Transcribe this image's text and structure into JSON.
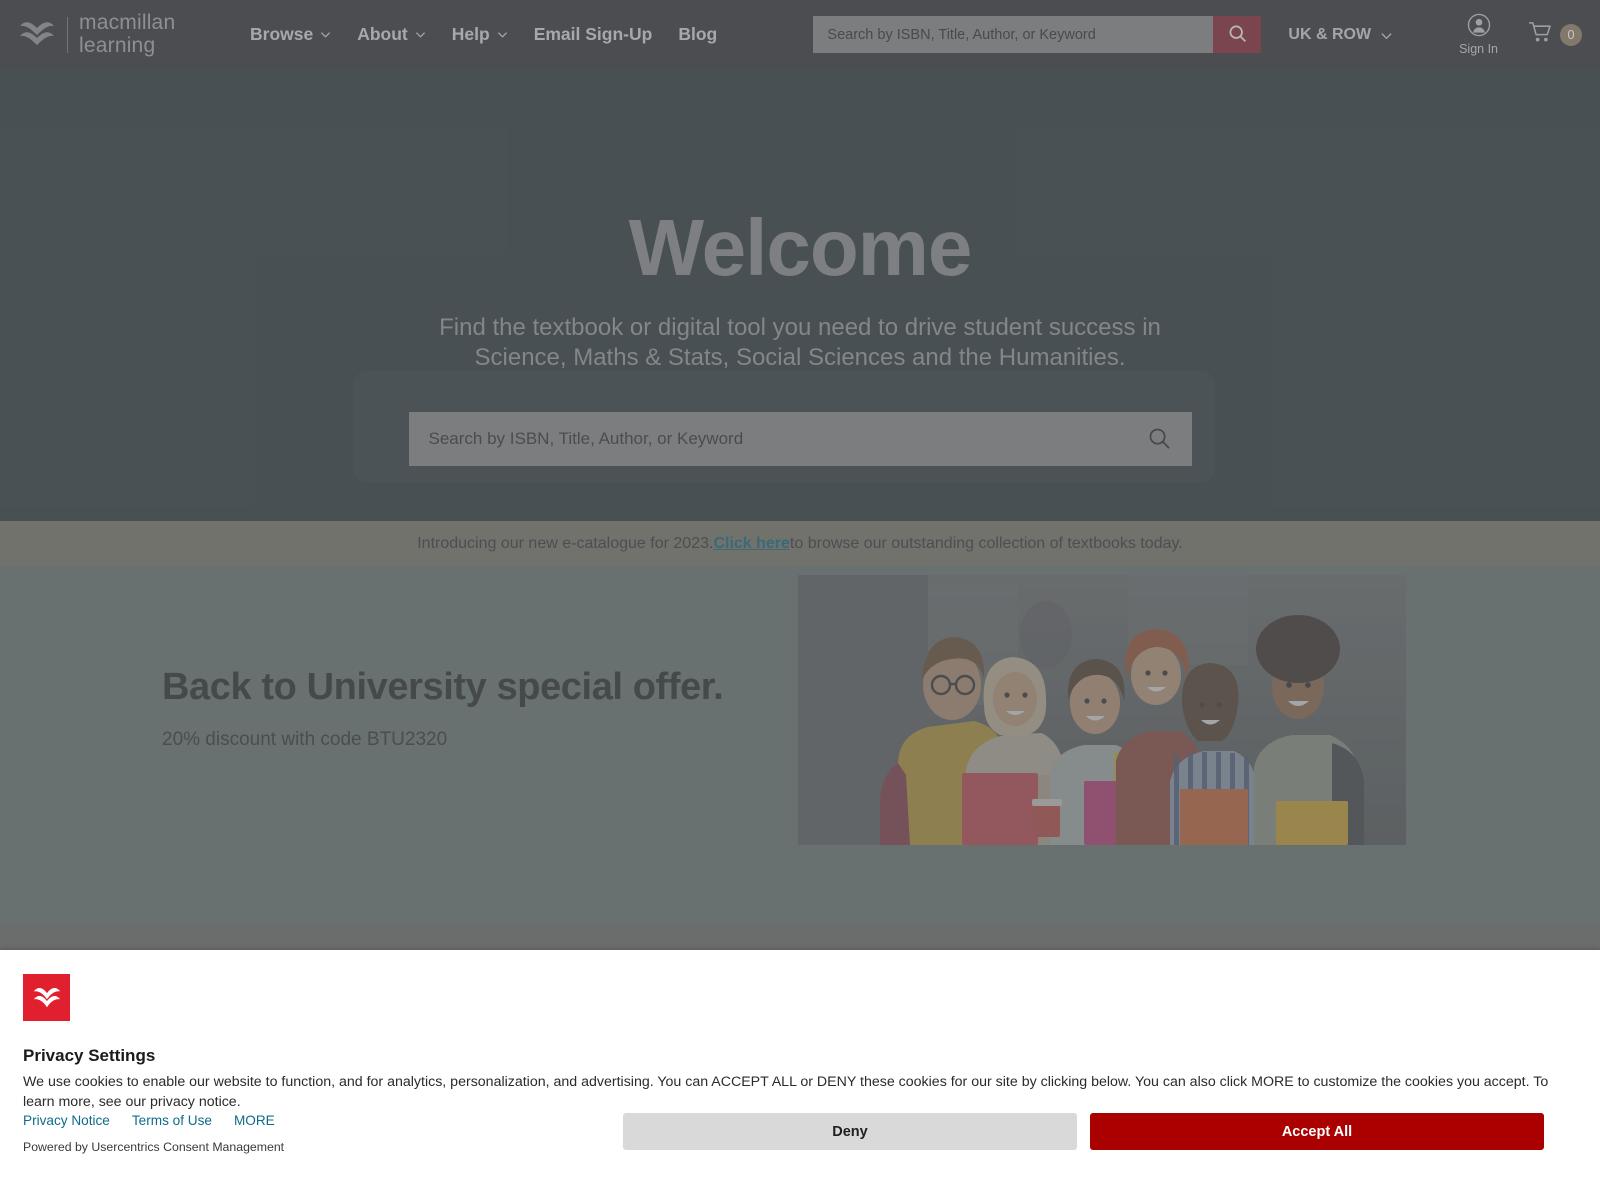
{
  "brand": {
    "logo_name": "macmillan learning",
    "logo_line1": "macmillan",
    "logo_line2": "learning",
    "accent_red": "#7e2230",
    "cookie_red": "#e0202e",
    "accept_red": "#ab0000",
    "link_teal": "#0f6b8c"
  },
  "header": {
    "nav": [
      {
        "label": "Browse",
        "has_caret": true
      },
      {
        "label": "About",
        "has_caret": true
      },
      {
        "label": "Help",
        "has_caret": true
      },
      {
        "label": "Email Sign-Up",
        "has_caret": false
      },
      {
        "label": "Blog",
        "has_caret": false
      }
    ],
    "search": {
      "placeholder": "Search by ISBN, Title, Author, or Keyword",
      "value": "",
      "button_icon": "search-icon"
    },
    "region": {
      "label": "UK & ROW",
      "icon": "chevron-down-icon"
    },
    "signin": {
      "label": "Sign In",
      "icon": "user-avatar-icon"
    },
    "cart": {
      "icon": "shopping-cart-icon",
      "count": "0"
    }
  },
  "hero": {
    "title": "Welcome",
    "subtitle": "Find the textbook or digital tool you need to drive student success in Science, Maths & Stats, Social Sciences and the Humanities.",
    "search": {
      "placeholder": "Search by ISBN, Title, Author, or Keyword",
      "value": "",
      "icon": "search-icon"
    }
  },
  "promo": {
    "before": "Introducing our new e-catalogue for 2023. ",
    "link": "Click here",
    "after": " to browse our outstanding collection of textbooks today."
  },
  "offer": {
    "title": "Back to University special offer.",
    "subtitle": "20% discount with code BTU2320",
    "photo_alt": "group-of-smiling-university-students-holding-notebooks"
  },
  "cookie": {
    "logo_icon": "macmillan-m-icon",
    "title": "Privacy Settings",
    "body": "We use cookies to enable our website to function, and for analytics, personalization, and advertising. You can ACCEPT ALL or DENY these cookies for our site by clicking below. You can also click MORE to customize the cookies you accept. To learn more, see our privacy notice.",
    "links": [
      "Privacy Notice",
      "Terms of Use",
      "MORE"
    ],
    "powered_by": "Powered by Usercentrics Consent Management",
    "deny_label": "Deny",
    "accept_label": "Accept All"
  }
}
